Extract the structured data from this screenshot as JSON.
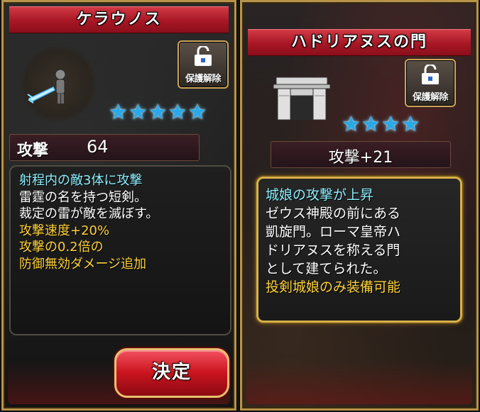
{
  "left": {
    "title": "ケラウノス",
    "unlock_label": "保護解除",
    "stars": "★★★★★",
    "stat_label": "攻撃",
    "stat_value": "64",
    "desc_lines": [
      "射程内の敵3体に攻撃",
      "雷霆の名を持つ短剣。",
      "裁定の雷が敵を滅ぼす。",
      "攻撃速度+20%",
      "攻撃の0.2倍の",
      "防御無効ダメージ追加"
    ],
    "decide_label": "決定"
  },
  "right": {
    "title": "ハドリアヌスの門",
    "unlock_label": "保護解除",
    "stars": "★★★★",
    "stat_text": "攻撃+21",
    "desc_lines": [
      "城娘の攻撃が上昇",
      "ゼウス神殿の前にある",
      "凱旋門。ローマ皇帝ハ",
      "ドリアヌスを称える門",
      "として建てられた。",
      "投剣城娘のみ装備可能"
    ]
  },
  "icons": {
    "star": "star-icon",
    "lock": "lock-icon",
    "weapon": "dagger-icon",
    "gate": "gate-icon"
  },
  "colors": {
    "title_red": "#a81624",
    "star_blue": "#29a9e8",
    "highlight_cyan": "#8ef0ff",
    "highlight_yellow": "#ffd23a",
    "frame_gold": "#b8934a"
  }
}
